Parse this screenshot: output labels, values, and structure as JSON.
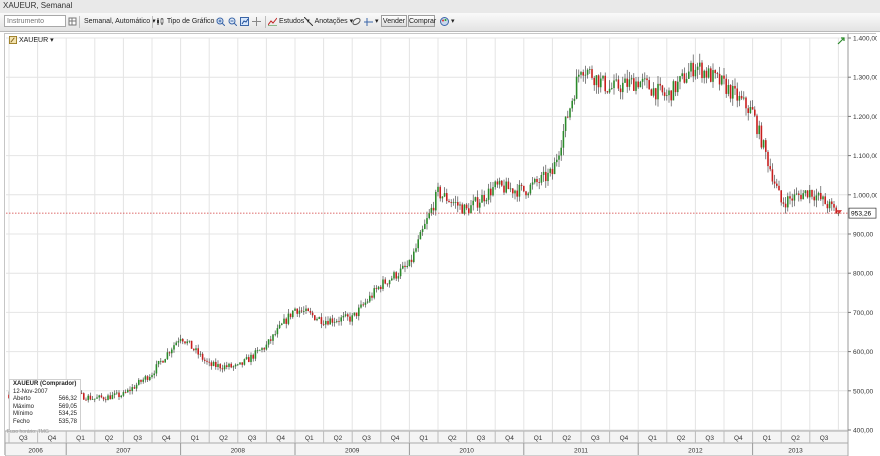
{
  "window": {
    "title": "XAUEUR, Semanal"
  },
  "toolbar": {
    "instrument_placeholder": "Instrumento",
    "period_label": "Semanal, Automático",
    "chart_type_label": "Tipo de Gráfico",
    "studies_label": "Estudos",
    "annotations_label": "Anotações",
    "sell_label": "Vender",
    "buy_label": "Comprar"
  },
  "symbol": {
    "label": "XAUEUR"
  },
  "info": {
    "title": "XAUEUR (Comprador)",
    "date": "12-Nov-2007",
    "rows": [
      {
        "label": "Aberto",
        "value": "566,32"
      },
      {
        "label": "Máximo",
        "value": "569,05"
      },
      {
        "label": "Mínimo",
        "value": "534,25"
      },
      {
        "label": "Fecho",
        "value": "535,78"
      }
    ]
  },
  "credit": "Fuso horário: TMG",
  "colors": {
    "up": "#2b8a2b",
    "down": "#c81e1e",
    "grid": "#e4e4e4",
    "price_line": "#d23a3a"
  },
  "chart_data": {
    "type": "candlestick",
    "title": "XAUEUR, Semanal",
    "ylim": [
      400,
      1400
    ],
    "y_ticks": [
      "1.400,00",
      "1.300,00",
      "1.200,00",
      "1.100,00",
      "1.000,00",
      "900,00",
      "800,00",
      "700,00",
      "600,00",
      "500,00",
      "400,00"
    ],
    "current_price": "953,26",
    "quarters": [
      "Q3",
      "Q4",
      "Q1",
      "Q2",
      "Q3",
      "Q4",
      "Q1",
      "Q2",
      "Q3",
      "Q4",
      "Q1",
      "Q2",
      "Q3",
      "Q4",
      "Q1",
      "Q2",
      "Q3",
      "Q4",
      "Q1",
      "Q2",
      "Q3",
      "Q4",
      "Q1",
      "Q2",
      "Q3",
      "Q4",
      "Q1",
      "Q2",
      "Q3"
    ],
    "years": [
      "2006",
      "2007",
      "2008",
      "2009",
      "2010",
      "2011",
      "2012",
      "2013"
    ],
    "series": [
      {
        "values": [
          {
            "x": "2006-Q3",
            "close": 490
          },
          {
            "x": "2006-Q4",
            "close": 498
          },
          {
            "x": "2007-Q1",
            "close": 495
          },
          {
            "x": "2007-Q2",
            "close": 480
          },
          {
            "x": "2007-Q3",
            "close": 490
          },
          {
            "x": "2007-Q4",
            "close": 545
          },
          {
            "x": "2008-Q1",
            "close": 640
          },
          {
            "x": "2008-Q2",
            "close": 565
          },
          {
            "x": "2008-Q3",
            "close": 560
          },
          {
            "x": "2008-Q4",
            "close": 615
          },
          {
            "x": "2009-Q1",
            "close": 710
          },
          {
            "x": "2009-Q2",
            "close": 680
          },
          {
            "x": "2009-Q3",
            "close": 685
          },
          {
            "x": "2009-Q4",
            "close": 770
          },
          {
            "x": "2010-Q1",
            "close": 820
          },
          {
            "x": "2010-Q2",
            "close": 1005
          },
          {
            "x": "2010-Q3",
            "close": 960
          },
          {
            "x": "2010-Q4",
            "close": 1020
          },
          {
            "x": "2011-Q1",
            "close": 1010
          },
          {
            "x": "2011-Q2",
            "close": 1055
          },
          {
            "x": "2011-Q3",
            "close": 1330
          },
          {
            "x": "2011-Q4",
            "close": 1270
          },
          {
            "x": "2012-Q1",
            "close": 1290
          },
          {
            "x": "2012-Q2",
            "close": 1250
          },
          {
            "x": "2012-Q3",
            "close": 1330
          },
          {
            "x": "2012-Q4",
            "close": 1280
          },
          {
            "x": "2013-Q1",
            "close": 1210
          },
          {
            "x": "2013-Q2",
            "close": 980
          },
          {
            "x": "2013-Q3",
            "close": 1010
          },
          {
            "x": "2013-Q4",
            "close": 953
          }
        ]
      }
    ]
  }
}
